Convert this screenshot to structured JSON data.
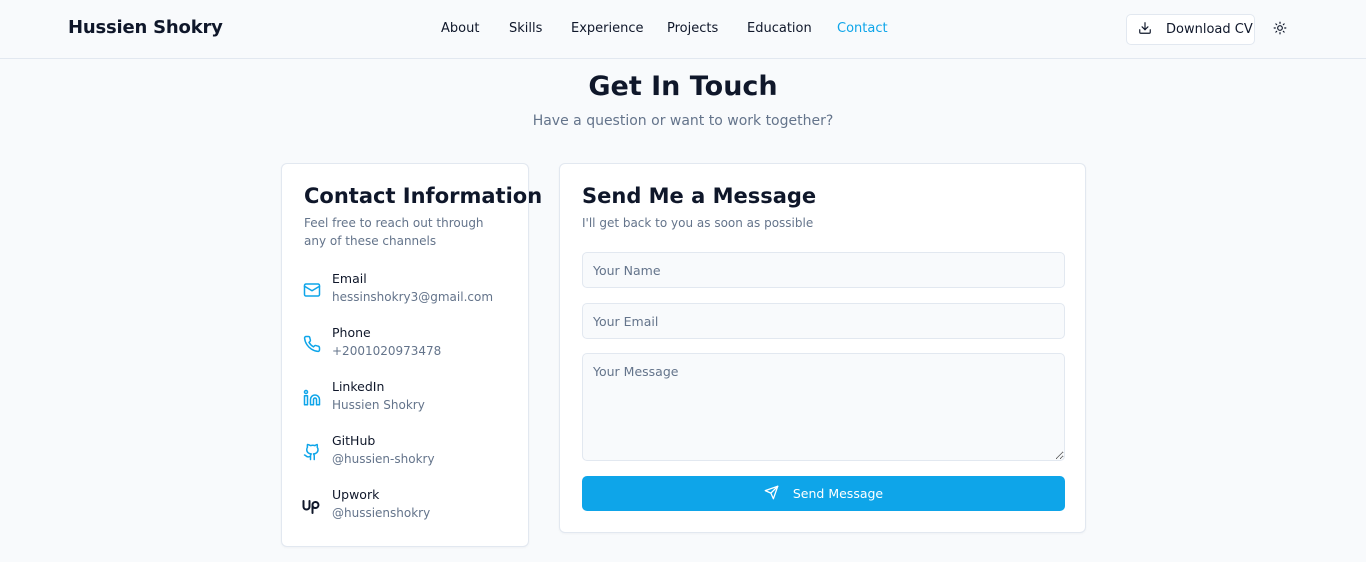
{
  "header": {
    "brand": "Hussien Shokry",
    "nav": [
      {
        "label": "About"
      },
      {
        "label": "Skills"
      },
      {
        "label": "Experience"
      },
      {
        "label": "Projects"
      },
      {
        "label": "Education"
      },
      {
        "label": "Contact",
        "active": true
      }
    ],
    "download_cv_label": "Download CV",
    "download_icon": "download-icon",
    "theme_icon": "sun-icon"
  },
  "section": {
    "title": "Get In Touch",
    "subtitle": "Have a question or want to work together?"
  },
  "contact_info": {
    "title": "Contact Information",
    "description": "Feel free to reach out through any of these channels",
    "items": [
      {
        "icon": "mail-icon",
        "label": "Email",
        "value": "hessinshokry3@gmail.com"
      },
      {
        "icon": "phone-icon",
        "label": "Phone",
        "value": "+2001020973478"
      },
      {
        "icon": "linkedin-icon",
        "label": "LinkedIn",
        "value": "Hussien Shokry"
      },
      {
        "icon": "github-icon",
        "label": "GitHub",
        "value": "@hussien-shokry"
      },
      {
        "icon": "upwork-icon",
        "label": "Upwork",
        "value": "@hussienshokry"
      }
    ]
  },
  "message_form": {
    "title": "Send Me a Message",
    "description": "I'll get back to you as soon as possible",
    "name_placeholder": "Your Name",
    "name_value": "",
    "email_placeholder": "Your Email",
    "email_value": "",
    "message_placeholder": "Your Message",
    "message_value": "",
    "send_label": "Send Message",
    "send_icon": "send-icon"
  },
  "colors": {
    "accent": "#0ea5e9",
    "background": "#f8fafc",
    "text": "#0f172a",
    "muted": "#64748b",
    "border": "#e2e8f0"
  }
}
